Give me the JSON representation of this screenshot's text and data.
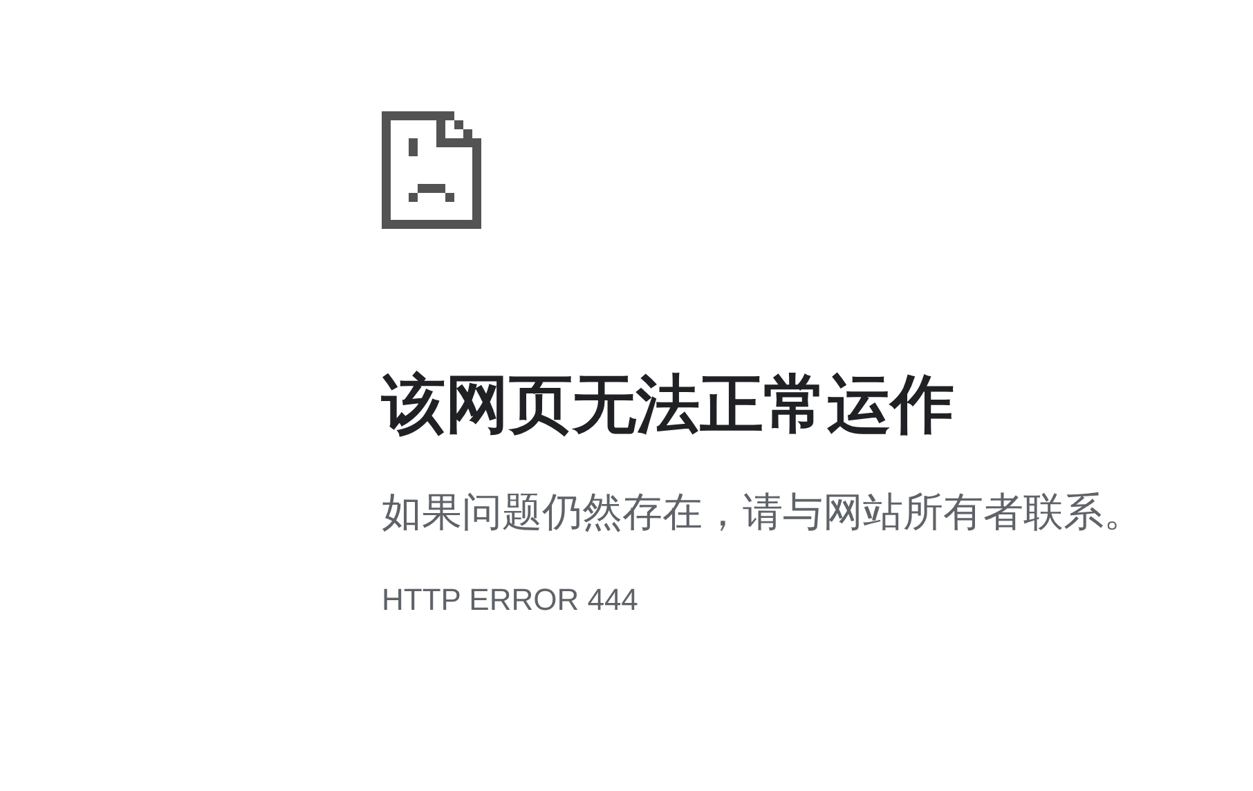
{
  "heading": "该网页无法正常运作",
  "message": "如果问题仍然存在，请与网站所有者联系。",
  "error_code": "HTTP ERROR 444"
}
